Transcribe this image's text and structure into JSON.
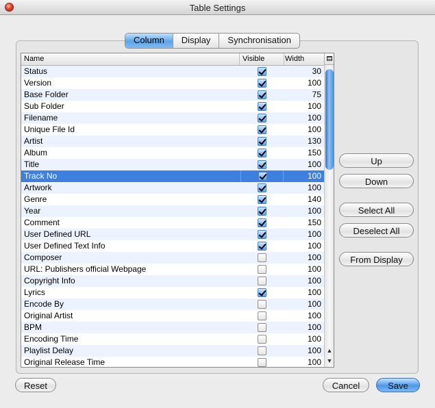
{
  "window": {
    "title": "Table Settings"
  },
  "tabs": [
    {
      "label": "Column",
      "active": true
    },
    {
      "label": "Display",
      "active": false
    },
    {
      "label": "Synchronisation",
      "active": false
    }
  ],
  "table": {
    "headers": {
      "name": "Name",
      "visible": "Visible",
      "width": "Width"
    },
    "rows": [
      {
        "name": "Status",
        "visible": true,
        "width": "30"
      },
      {
        "name": "Version",
        "visible": true,
        "width": "100"
      },
      {
        "name": "Base Folder",
        "visible": true,
        "width": "75"
      },
      {
        "name": "Sub Folder",
        "visible": true,
        "width": "100"
      },
      {
        "name": "Filename",
        "visible": true,
        "width": "100"
      },
      {
        "name": "Unique File Id",
        "visible": true,
        "width": "100"
      },
      {
        "name": "Artist",
        "visible": true,
        "width": "130"
      },
      {
        "name": "Album",
        "visible": true,
        "width": "150"
      },
      {
        "name": "Title",
        "visible": true,
        "width": "100"
      },
      {
        "name": "Track No",
        "visible": true,
        "width": "100",
        "selected": true
      },
      {
        "name": "Artwork",
        "visible": true,
        "width": "100"
      },
      {
        "name": "Genre",
        "visible": true,
        "width": "140"
      },
      {
        "name": "Year",
        "visible": true,
        "width": "100"
      },
      {
        "name": "Comment",
        "visible": true,
        "width": "150"
      },
      {
        "name": "User Defined URL",
        "visible": true,
        "width": "100"
      },
      {
        "name": "User Defined Text Info",
        "visible": true,
        "width": "100"
      },
      {
        "name": "Composer",
        "visible": false,
        "width": "100"
      },
      {
        "name": "URL: Publishers official Webpage",
        "visible": false,
        "width": "100"
      },
      {
        "name": "Copyright Info",
        "visible": false,
        "width": "100"
      },
      {
        "name": "Lyrics",
        "visible": true,
        "width": "100"
      },
      {
        "name": "Encode By",
        "visible": false,
        "width": "100"
      },
      {
        "name": "Original Artist",
        "visible": false,
        "width": "100"
      },
      {
        "name": "BPM",
        "visible": false,
        "width": "100"
      },
      {
        "name": "Encoding Time",
        "visible": false,
        "width": "100"
      },
      {
        "name": "Playlist Delay",
        "visible": false,
        "width": "100"
      },
      {
        "name": "Original Release Time",
        "visible": false,
        "width": "100"
      }
    ],
    "scroll_icons": {
      "up": "scroll-up-arrow-icon",
      "down": "scroll-down-arrow-icon",
      "corner": "column-chooser-icon"
    }
  },
  "side_buttons": {
    "up": "Up",
    "down": "Down",
    "select_all": "Select All",
    "deselect_all": "Deselect All",
    "from_display": "From Display"
  },
  "footer": {
    "reset": "Reset",
    "cancel": "Cancel",
    "save": "Save"
  },
  "colors": {
    "selection": "#3d80df",
    "accent": "#5aa5ea",
    "stripe": "#edf3fe"
  }
}
